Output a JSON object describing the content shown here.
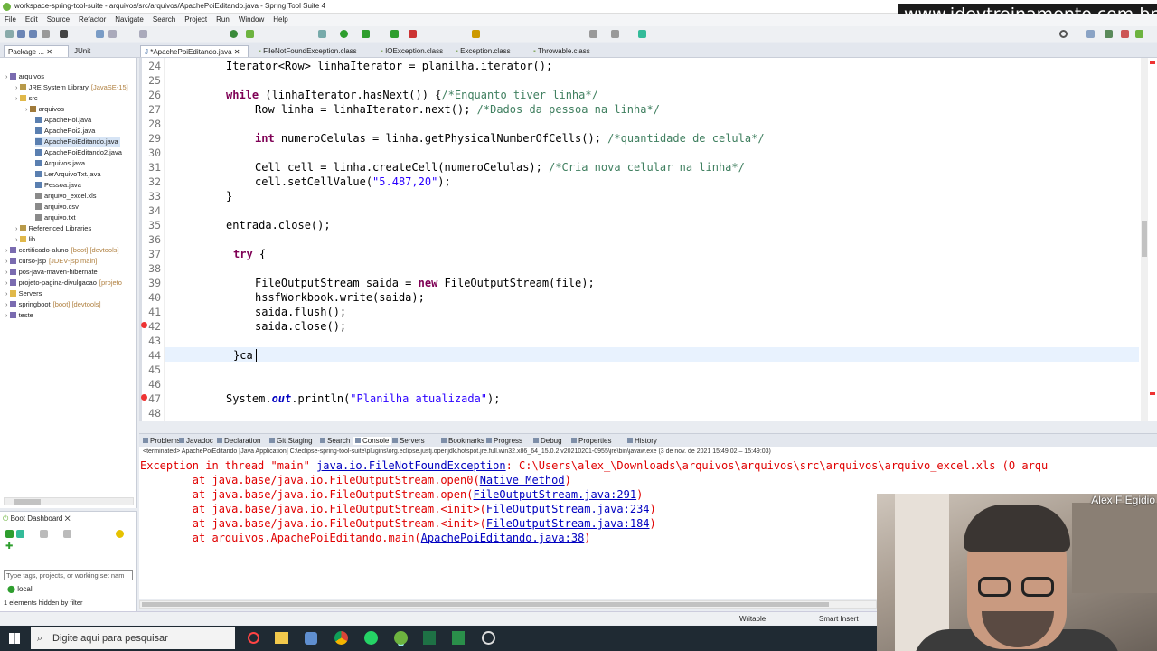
{
  "window": {
    "title": "workspace-spring-tool-suite - arquivos/src/arquivos/ApachePoiEditando.java - Spring Tool Suite 4",
    "watermark": "www.jdevtreinamento.com.br"
  },
  "menu": [
    "File",
    "Edit",
    "Source",
    "Refactor",
    "Navigate",
    "Search",
    "Project",
    "Run",
    "Window",
    "Help"
  ],
  "left_tabs": {
    "package": "Package ...",
    "junit": "JUnit"
  },
  "editor_tabs": [
    {
      "label": "*ApachePoiEditando.java",
      "active": true
    },
    {
      "label": "FileNotFoundException.class",
      "active": false
    },
    {
      "label": "IOException.class",
      "active": false
    },
    {
      "label": "Exception.class",
      "active": false
    },
    {
      "label": "Throwable.class",
      "active": false
    }
  ],
  "tree": [
    {
      "label": "arquivos",
      "level": 0,
      "icon": "project-icon"
    },
    {
      "label": "JRE System Library",
      "suffix": "[JavaSE-15]",
      "level": 1,
      "icon": "library-icon"
    },
    {
      "label": "src",
      "level": 1,
      "icon": "folder-icon"
    },
    {
      "label": "arquivos",
      "level": 2,
      "icon": "package-icon"
    },
    {
      "label": "ApachePoi.java",
      "level": 3,
      "icon": "java-file-icon"
    },
    {
      "label": "ApachePoi2.java",
      "level": 3,
      "icon": "java-file-icon"
    },
    {
      "label": "ApachePoiEditando.java",
      "level": 3,
      "icon": "java-file-icon",
      "selected": true
    },
    {
      "label": "ApachePoiEditando2.java",
      "level": 3,
      "icon": "java-file-icon"
    },
    {
      "label": "Arquivos.java",
      "level": 3,
      "icon": "java-file-icon"
    },
    {
      "label": "LerArquivoTxt.java",
      "level": 3,
      "icon": "java-file-icon"
    },
    {
      "label": "Pessoa.java",
      "level": 3,
      "icon": "java-file-icon"
    },
    {
      "label": "arquivo_excel.xls",
      "level": 3,
      "icon": "file-icon"
    },
    {
      "label": "arquivo.csv",
      "level": 3,
      "icon": "file-icon"
    },
    {
      "label": "arquivo.txt",
      "level": 3,
      "icon": "file-icon"
    },
    {
      "label": "Referenced Libraries",
      "level": 1,
      "icon": "library-icon"
    },
    {
      "label": "lib",
      "level": 1,
      "icon": "folder-icon"
    },
    {
      "label": "certificado-aluno",
      "suffix": "[boot] [devtools]",
      "level": 0,
      "icon": "project-icon"
    },
    {
      "label": "curso-jsp",
      "suffix": "[JDEV-jsp main]",
      "level": 0,
      "icon": "project-icon"
    },
    {
      "label": "pos-java-maven-hibernate",
      "level": 0,
      "icon": "project-icon"
    },
    {
      "label": "projeto-pagina-divulgacao",
      "suffix": "[projeto",
      "level": 0,
      "icon": "project-icon"
    },
    {
      "label": "Servers",
      "level": 0,
      "icon": "folder-icon"
    },
    {
      "label": "springboot",
      "suffix": "[boot] [devtools]",
      "level": 0,
      "icon": "project-icon"
    },
    {
      "label": "teste",
      "level": 0,
      "icon": "project-icon"
    }
  ],
  "boot_dashboard": {
    "title": "Boot Dashboard",
    "filter_placeholder": "Type tags, projects, or working set nam",
    "item": "local",
    "hidden_note": "1 elements hidden by filter"
  },
  "code": {
    "line_numbers": [
      "24",
      "25",
      "26",
      "27",
      "28",
      "29",
      "30",
      "31",
      "32",
      "33",
      "34",
      "35",
      "36",
      "37",
      "38",
      "39",
      "40",
      "41",
      "42",
      "43",
      "44",
      "45",
      "46",
      "47",
      "48"
    ],
    "l24": "Iterator<Row> linhaIterator = planilha.iterator();",
    "l26_kw": "while",
    "l26_code": " (linhaIterator.hasNext()) {",
    "l26_cm": "/*Enquanto tiver linha*/",
    "l27_code": "Row linha = linhaIterator.next(); ",
    "l27_cm": "/*Dados da pessoa na linha*/",
    "l29_kw": "int",
    "l29_code": " numeroCelulas = linha.getPhysicalNumberOfCells(); ",
    "l29_cm": "/*quantidade de celula*/",
    "l31_code": "Cell cell = linha.createCell(numeroCelulas); ",
    "l31_cm": "/*Cria nova celular na linha*/",
    "l32_code": "cell.setCellValue(",
    "l32_str": "\"5.487,20\"",
    "l32_end": ");",
    "l33": "}",
    "l35": "entrada.close();",
    "l37_kw": "try",
    "l37_end": " {",
    "l39_code": "FileOutputStream saida = ",
    "l39_kw": "new",
    "l39_end": " FileOutputStream(file);",
    "l40": "hssfWorkbook.write(saida);",
    "l41": "saida.flush();",
    "l42": "saida.close();",
    "l44": "}ca",
    "l47_a": "System.",
    "l47_fd": "out",
    "l47_b": ".println(",
    "l47_str": "\"Planilha atualizada\"",
    "l47_c": ");"
  },
  "console_tabs": [
    "Problems",
    "Javadoc",
    "Declaration",
    "Git Staging",
    "Search",
    "Console",
    "Servers",
    "Bookmarks",
    "Progress",
    "Debug",
    "Properties",
    "History"
  ],
  "console": {
    "terminated": "<terminated> ApachePoiEditando [Java Application] C:\\eclipse-spring-tool-suite\\plugins\\org.eclipse.justj.openjdk.hotspot.jre.full.win32.x86_64_15.0.2.v20210201-0955\\jre\\bin\\javaw.exe (3 de nov. de 2021 15:49:02 – 15:49:03)",
    "line1_a": "Exception in thread \"main\" ",
    "line1_link": "java.io.FileNotFoundException",
    "line1_b": ": C:\\Users\\alex_\\Downloads\\arquivos\\arquivos\\src\\arquivos\\arquivo_excel.xls (O arqu",
    "stack": [
      {
        "at": "        at java.base/java.io.FileOutputStream.open0(",
        "link": "Native Method",
        "end": ")"
      },
      {
        "at": "        at java.base/java.io.FileOutputStream.open(",
        "link": "FileOutputStream.java:291",
        "end": ")"
      },
      {
        "at": "        at java.base/java.io.FileOutputStream.<init>(",
        "link": "FileOutputStream.java:234",
        "end": ")"
      },
      {
        "at": "        at java.base/java.io.FileOutputStream.<init>(",
        "link": "FileOutputStream.java:184",
        "end": ")"
      },
      {
        "at": "        at arquivos.ApachePoiEditando.main(",
        "link": "ApachePoiEditando.java:38",
        "end": ")"
      }
    ]
  },
  "status": {
    "writable": "Writable",
    "insert": "Smart Insert"
  },
  "taskbar": {
    "search": "Digite aqui para pesquisar"
  },
  "webcam": {
    "name": "Alex F Egidio"
  }
}
